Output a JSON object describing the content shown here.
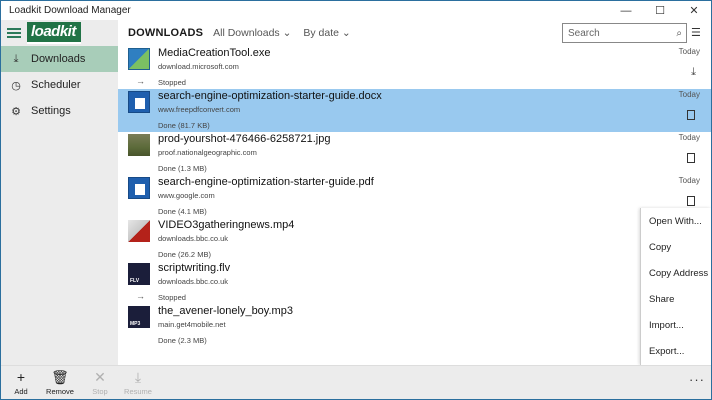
{
  "window": {
    "title": "Loadkit Download Manager",
    "minimize": "—",
    "maximize": "☐",
    "close": "✕"
  },
  "sidebar": {
    "logo": "loadkit",
    "items": [
      {
        "label": "Downloads",
        "icon": "download-icon",
        "glyph": "⤓",
        "active": true
      },
      {
        "label": "Scheduler",
        "icon": "clock-icon",
        "glyph": "◷",
        "active": false
      },
      {
        "label": "Settings",
        "icon": "gear-icon",
        "glyph": "⚙",
        "active": false
      }
    ]
  },
  "header": {
    "title": "DOWNLOADS",
    "filter_label": "All Downloads ⌄",
    "sort_label": "By date ⌄",
    "search_placeholder": "Search",
    "search_glyph": "⌕",
    "list_options_glyph": "☰"
  },
  "downloads": [
    {
      "name": "MediaCreationTool.exe",
      "source": "download.microsoft.com",
      "status": "Stopped",
      "date": "Today",
      "thumb": "exe",
      "action": "download",
      "selected": false
    },
    {
      "name": "search-engine-optimization-starter-guide.docx",
      "source": "www.freepdfconvert.com",
      "status": "Done (81.7 KB)",
      "date": "Today",
      "thumb": "doc",
      "action": "open",
      "selected": true
    },
    {
      "name": "prod-yourshot-476466-6258721.jpg",
      "source": "proof.nationalgeographic.com",
      "status": "Done (1.3 MB)",
      "date": "Today",
      "thumb": "jpg",
      "action": "open",
      "selected": false
    },
    {
      "name": "search-engine-optimization-starter-guide.pdf",
      "source": "www.google.com",
      "status": "Done (4.1 MB)",
      "date": "Today",
      "thumb": "pdf",
      "action": "open",
      "selected": false
    },
    {
      "name": "VIDEO3gatheringnews.mp4",
      "source": "downloads.bbc.co.uk",
      "status": "Done (26.2 MB)",
      "date": "",
      "thumb": "mp4",
      "action": "",
      "selected": false
    },
    {
      "name": "scriptwriting.flv",
      "source": "downloads.bbc.co.uk",
      "status": "Stopped",
      "date": "",
      "thumb": "flv",
      "action": "",
      "selected": false
    },
    {
      "name": "the_avener-lonely_boy.mp3",
      "source": "main.get4mobile.net",
      "status": "Done (2.3 MB)",
      "date": "",
      "thumb": "mp3",
      "action": "",
      "selected": false
    }
  ],
  "context_menu": [
    "Open With...",
    "Copy",
    "Copy Address",
    "Share",
    "Import...",
    "Export..."
  ],
  "toolbar": [
    {
      "label": "Add",
      "glyph": "+",
      "icon": "add-icon",
      "enabled": true
    },
    {
      "label": "Remove",
      "glyph": "🗑",
      "icon": "trash-icon",
      "enabled": true
    },
    {
      "label": "Stop",
      "glyph": "✕",
      "icon": "stop-icon",
      "enabled": false
    },
    {
      "label": "Resume",
      "glyph": "⤓",
      "icon": "resume-icon",
      "enabled": false
    }
  ],
  "more_glyph": "···"
}
